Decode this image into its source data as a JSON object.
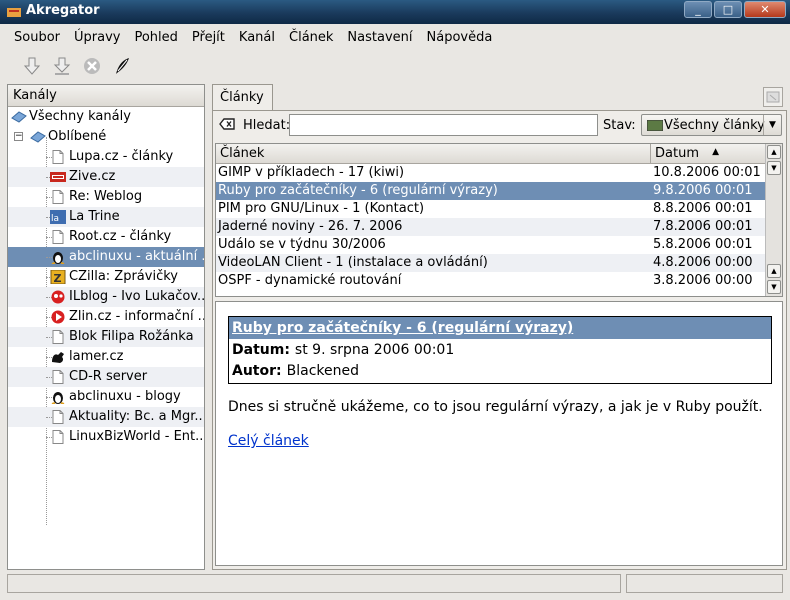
{
  "window": {
    "title": "Akregator"
  },
  "menu": [
    "Soubor",
    "Úpravy",
    "Pohled",
    "Přejít",
    "Kanál",
    "Článek",
    "Nastavení",
    "Nápověda"
  ],
  "sidebar": {
    "header": "Kanály",
    "root": "Všechny kanály",
    "folder": "Oblíbené",
    "feeds": [
      {
        "label": "Lupa.cz - články",
        "icon": "page-icon"
      },
      {
        "label": "Zive.cz",
        "icon": "zive-icon"
      },
      {
        "label": "Re: Weblog",
        "icon": "page-icon"
      },
      {
        "label": "La Trine",
        "icon": "latrine-icon"
      },
      {
        "label": "Root.cz - články",
        "icon": "page-icon"
      },
      {
        "label": "abclinuxu - aktuální ...",
        "icon": "tux-icon"
      },
      {
        "label": "CZilla: Zprávičky",
        "icon": "czilla-icon"
      },
      {
        "label": "ILblog - Ivo Lukačov...",
        "icon": "ilblog-icon"
      },
      {
        "label": "Zlin.cz - informační ...",
        "icon": "zlin-icon"
      },
      {
        "label": "Blok Filipa Rožánka",
        "icon": "page-icon"
      },
      {
        "label": "lamer.cz",
        "icon": "lamer-icon"
      },
      {
        "label": "CD-R server",
        "icon": "page-icon"
      },
      {
        "label": "abclinuxu - blogy",
        "icon": "tux-icon"
      },
      {
        "label": "Aktuality: Bc. a Mgr....",
        "icon": "page-icon"
      },
      {
        "label": "LinuxBizWorld - Ent...",
        "icon": "page-icon"
      }
    ]
  },
  "tabs": {
    "active": "Články"
  },
  "search": {
    "label": "Hledat:",
    "value": ""
  },
  "status_filter": {
    "label": "Stav:",
    "value": "Všechny články"
  },
  "articles": {
    "col_title": "Článek",
    "col_date": "Datum",
    "rows": [
      {
        "title": "GIMP v příkladech - 17 (kiwi)",
        "date": "10.8.2006 00:01"
      },
      {
        "title": "Ruby pro začátečníky - 6 (regulární výrazy)",
        "date": "9.8.2006 00:01"
      },
      {
        "title": "PIM pro GNU/Linux - 1 (Kontact)",
        "date": "8.8.2006 00:01"
      },
      {
        "title": "Jaderné noviny - 26. 7. 2006",
        "date": "7.8.2006 00:01"
      },
      {
        "title": "Událo se v týdnu 30/2006",
        "date": "5.8.2006 00:01"
      },
      {
        "title": "VideoLAN Client - 1 (instalace a ovládání)",
        "date": "4.8.2006 00:00"
      },
      {
        "title": "OSPF - dynamické routování",
        "date": "3.8.2006 00:00"
      }
    ]
  },
  "article": {
    "title": "Ruby pro začátečníky - 6 (regulární výrazy)",
    "date_label": "Datum:",
    "date": "st 9. srpna 2006 00:01",
    "author_label": "Autor:",
    "author": "Blackened",
    "summary": "Dnes si stručně ukážeme, co to jsou regulární výrazy, a jak je v Ruby použít.",
    "link": "Celý článek"
  }
}
